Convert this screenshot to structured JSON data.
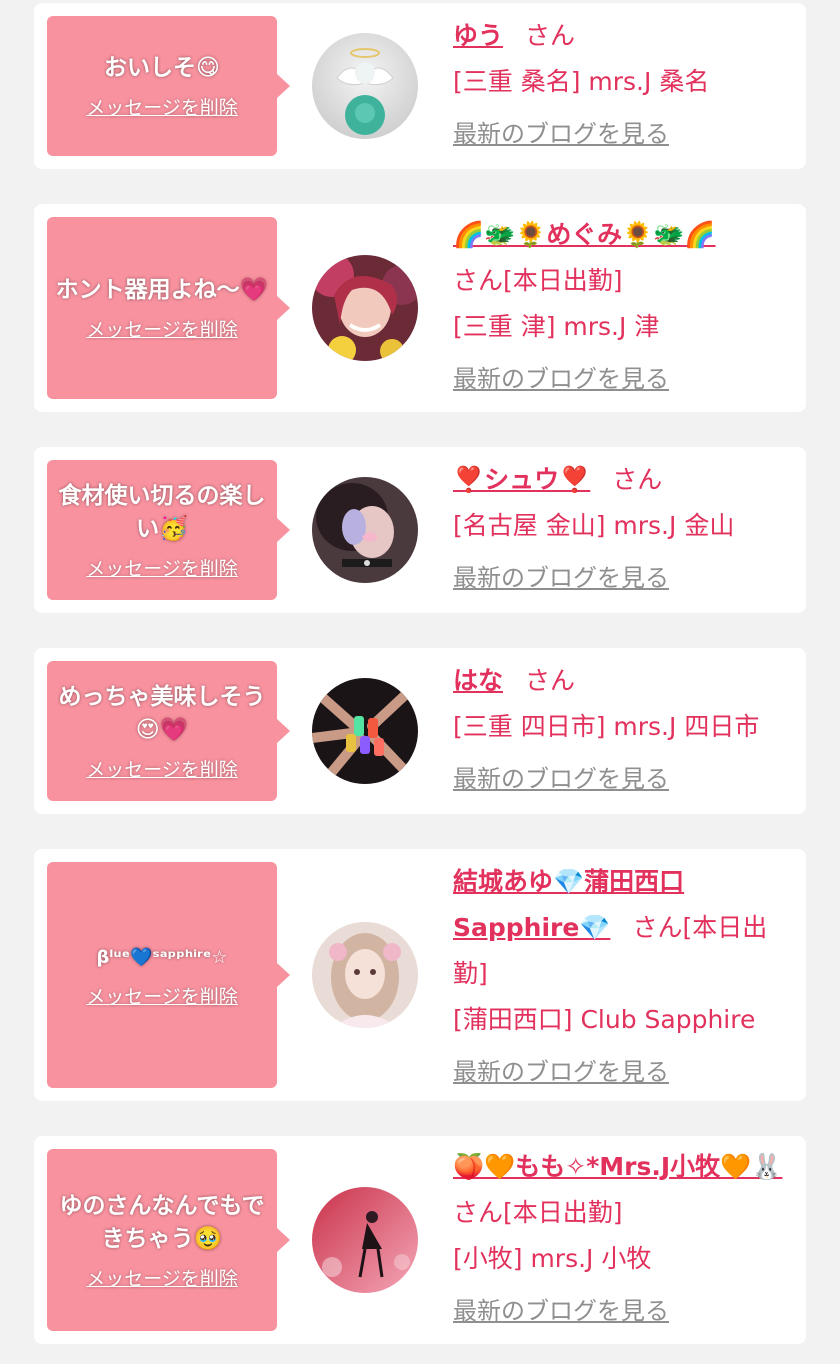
{
  "common": {
    "delete_label": "メッセージを削除",
    "blog_label": "最新のブログを見る",
    "san": "さん"
  },
  "messages": [
    {
      "message": "おいしそ😋",
      "name": "ゆう",
      "status": "",
      "shop": "[三重 桑名] mrs.J 桑名"
    },
    {
      "message": "ホント器用よね〜💗",
      "name": "🌈🐲🌻めぐみ🌻🐲🌈",
      "status": "[本日出勤]",
      "shop": "[三重 津] mrs.J 津"
    },
    {
      "message": "食材使い切るの楽しい🥳",
      "name": "❣️シュウ❣️",
      "status": "",
      "shop": "[名古屋 金山] mrs.J 金山"
    },
    {
      "message": "めっちゃ美味しそう😍💗",
      "name": "はな",
      "status": "",
      "shop": "[三重 四日市] mrs.J 四日市"
    },
    {
      "message": "βˡᵘᵉ💙ˢᵃᵖᵖʰⁱʳᵉ☆",
      "name_line1": "結城あゆ💎蒲田西口",
      "name_line2": "Sapphire💎",
      "status_line1": "[本日出",
      "status_line2": "勤]",
      "shop": "[蒲田西口] Club Sapphire"
    },
    {
      "message": "ゆのさんなんでもできちゃう🥹",
      "name": "🍑🧡もも✧*Mrs.J小牧🧡🐰",
      "status": "[本日出勤]",
      "shop": "[小牧] mrs.J 小牧"
    }
  ]
}
